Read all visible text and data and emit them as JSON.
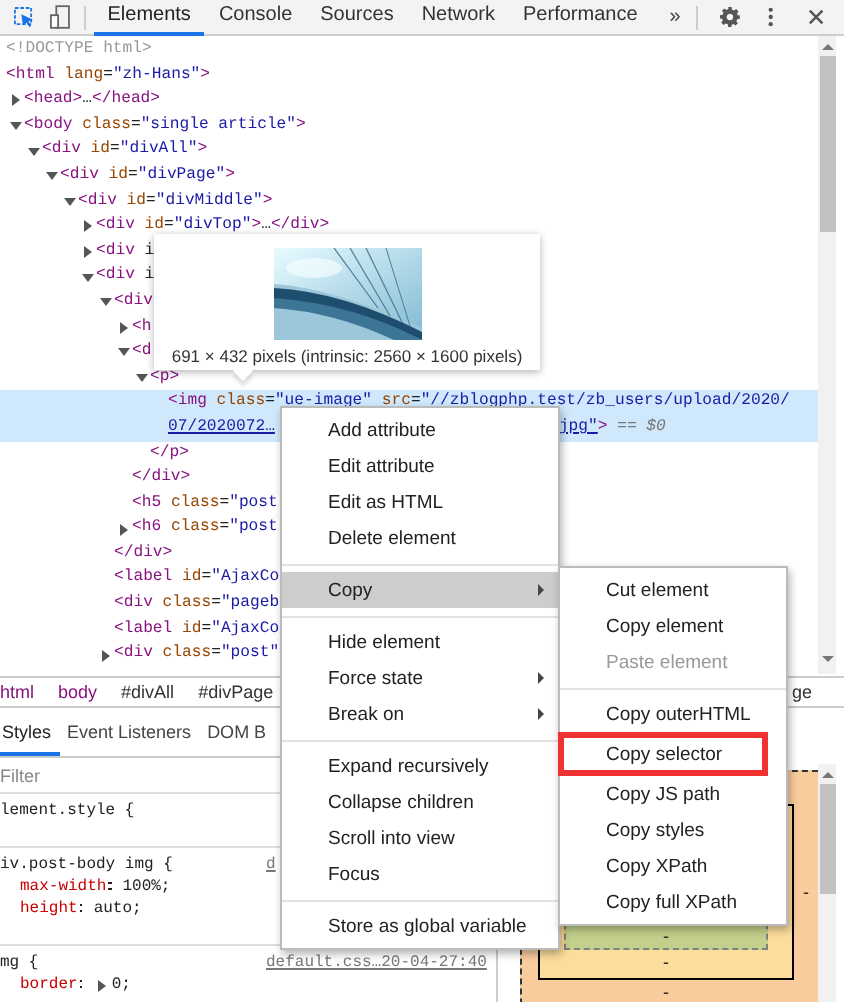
{
  "toolbar": {
    "tabs": [
      {
        "label": "Elements",
        "selected": true
      },
      {
        "label": "Console",
        "selected": false
      },
      {
        "label": "Sources",
        "selected": false
      },
      {
        "label": "Network",
        "selected": false
      },
      {
        "label": "Performance",
        "selected": false
      }
    ],
    "overflow": "»"
  },
  "dom_tree": [
    {
      "text": "<!DOCTYPE html>",
      "kind": "doctype",
      "selected": false
    },
    {
      "text": "<html lang=\"zh-Hans\">",
      "kind": "markup",
      "selected": false,
      "children": [
        {
          "text": "<head>…</head>",
          "kind": "markup",
          "expanded": false,
          "selected": false
        },
        {
          "text": "<body class=\"single article\">",
          "kind": "markup",
          "expanded": true,
          "selected": false,
          "children": [
            {
              "text": "<div id=\"divAll\">",
              "kind": "markup",
              "expanded": true,
              "selected": false,
              "children": [
                {
                  "text": "<div id=\"divPage\">",
                  "kind": "markup",
                  "expanded": true,
                  "selected": false,
                  "children": [
                    {
                      "text": "<div id=\"divMiddle\">",
                      "kind": "markup",
                      "expanded": true,
                      "selected": false,
                      "children": [
                        {
                          "text": "<div id=\"divTop\">…</div>",
                          "kind": "markup",
                          "expanded": false,
                          "selected": false
                        },
                        {
                          "text": "<div i",
                          "kind": "markup",
                          "expanded": false,
                          "selected": false
                        },
                        {
                          "text": "<div i",
                          "kind": "markup",
                          "expanded": true,
                          "selected": false,
                          "children": [
                            {
                              "text": "<div",
                              "kind": "markup",
                              "expanded": true,
                              "selected": false,
                              "children": [
                                {
                                  "text": "<h",
                                  "kind": "markup",
                                  "expanded": false,
                                  "selected": false
                                },
                                {
                                  "text": "<d",
                                  "kind": "markup",
                                  "expanded": true,
                                  "selected": false,
                                  "children": [
                                    {
                                      "text": "<p>",
                                      "kind": "markup",
                                      "expanded": true,
                                      "selected": false,
                                      "children": [
                                        {
                                          "text": "<img class=\"ue-image\" src=\"//zblogphp.test/zb_users/upload/2020/",
                                          "kind": "markup",
                                          "selected": true,
                                          "continuation": [
                                            "07/2020072…",
                                            "jpg\"> == $0"
                                          ]
                                        }
                                      ]
                                    },
                                    {
                                      "text": "</p>",
                                      "kind": "markup",
                                      "selected": false
                                    }
                                  ]
                                },
                                {
                                  "text": "</div>",
                                  "kind": "markup",
                                  "selected": false
                                },
                                {
                                  "text": "<h5 class=\"post",
                                  "kind": "markup",
                                  "selected": false
                                },
                                {
                                  "text": "<h6 class=\"post",
                                  "kind": "markup",
                                  "expanded": false,
                                  "selected": false
                                }
                              ]
                            },
                            {
                              "text": "</div>",
                              "kind": "markup",
                              "selected": false
                            },
                            {
                              "text": "<label id=\"AjaxCo",
                              "kind": "markup",
                              "selected": false
                            },
                            {
                              "text": "<div class=\"pageb",
                              "kind": "markup",
                              "selected": false
                            },
                            {
                              "text": "<label id=\"AjaxCo",
                              "kind": "markup",
                              "selected": false
                            },
                            {
                              "text": "<div class=\"post\"",
                              "kind": "markup",
                              "expanded": false,
                              "selected": false
                            }
                          ]
                        }
                      ]
                    }
                  ]
                }
              ]
            }
          ]
        }
      ]
    }
  ],
  "image_tooltip": {
    "kind": "picture",
    "caption": "691 × 432 pixels (intrinsic: 2560 × 1600 pixels)"
  },
  "breadcrumbs": [
    {
      "label": "html",
      "kind": "tag"
    },
    {
      "label": "body",
      "kind": "tag"
    },
    {
      "label": "#divAll",
      "kind": "id"
    },
    {
      "label": "#divPage",
      "kind": "id"
    },
    {
      "label": "ge",
      "kind": "id"
    }
  ],
  "styles_panel": {
    "tabs": [
      {
        "label": "Styles",
        "selected": true
      },
      {
        "label": "Event Listeners",
        "selected": false
      },
      {
        "label": "DOM B",
        "selected": false
      }
    ],
    "filter": {
      "placeholder": "Filter"
    },
    "rules": [
      {
        "selector": "lement.style {"
      },
      {
        "selector": "iv.post-body img {",
        "source": "d",
        "declarations": [
          {
            "property": "max-width",
            "value": "100%;"
          },
          {
            "property": "height",
            "value": "auto;"
          }
        ]
      },
      {
        "selector": "mg {",
        "source": "default.css…20-04-27:40",
        "declarations": [
          {
            "property": "border",
            "value": "0;",
            "expandable": true
          }
        ]
      }
    ]
  },
  "box_model": {
    "margin_right": "-",
    "padding_bottom": "-",
    "border_bottom": "-",
    "margin_bottom": "-"
  },
  "context_menu": {
    "items": [
      {
        "kind": "item",
        "label": "Add attribute",
        "selected": false
      },
      {
        "kind": "item",
        "label": "Edit attribute",
        "selected": false
      },
      {
        "kind": "item",
        "label": "Edit as HTML",
        "selected": false
      },
      {
        "kind": "item",
        "label": "Delete element",
        "selected": false
      },
      {
        "kind": "separator"
      },
      {
        "kind": "submenu",
        "label": "Copy",
        "selected": true
      },
      {
        "kind": "separator"
      },
      {
        "kind": "item",
        "label": "Hide element",
        "selected": false
      },
      {
        "kind": "submenu",
        "label": "Force state",
        "selected": false
      },
      {
        "kind": "submenu",
        "label": "Break on",
        "selected": false
      },
      {
        "kind": "separator"
      },
      {
        "kind": "item",
        "label": "Expand recursively",
        "selected": false
      },
      {
        "kind": "item",
        "label": "Collapse children",
        "selected": false
      },
      {
        "kind": "item",
        "label": "Scroll into view",
        "selected": false
      },
      {
        "kind": "item",
        "label": "Focus",
        "selected": false
      },
      {
        "kind": "separator"
      },
      {
        "kind": "item",
        "label": "Store as global variable",
        "selected": false
      }
    ]
  },
  "copy_submenu": {
    "items": [
      {
        "kind": "item",
        "label": "Cut element",
        "disabled": false,
        "marked": false
      },
      {
        "kind": "item",
        "label": "Copy element",
        "disabled": false,
        "marked": false
      },
      {
        "kind": "item",
        "label": "Paste element",
        "disabled": true,
        "marked": false
      },
      {
        "kind": "separator"
      },
      {
        "kind": "item",
        "label": "Copy outerHTML",
        "disabled": false,
        "marked": false
      },
      {
        "kind": "item",
        "label": "Copy selector",
        "disabled": false,
        "marked": true
      },
      {
        "kind": "item",
        "label": "Copy JS path",
        "disabled": false,
        "marked": false
      },
      {
        "kind": "item",
        "label": "Copy styles",
        "disabled": false,
        "marked": false
      },
      {
        "kind": "item",
        "label": "Copy XPath",
        "disabled": false,
        "marked": false
      },
      {
        "kind": "item",
        "label": "Copy full XPath",
        "disabled": false,
        "marked": false
      }
    ]
  }
}
